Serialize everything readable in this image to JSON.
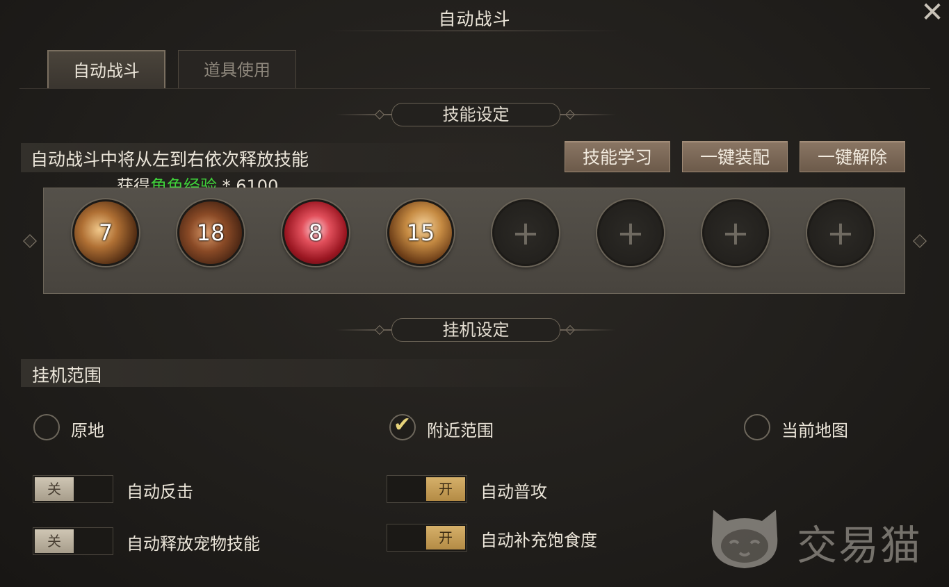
{
  "window": {
    "title": "自动战斗",
    "close_icon": "close-icon"
  },
  "tabs": [
    {
      "label": "自动战斗",
      "active": true
    },
    {
      "label": "道具使用",
      "active": false
    }
  ],
  "skill_section": {
    "header": "技能设定",
    "info": "自动战斗中将从左到右依次释放技能",
    "exp_prefix": "获得",
    "exp_highlight": "角色经验",
    "exp_suffix": " * 6100",
    "buttons": {
      "learn": "技能学习",
      "equip_all": "一键装配",
      "remove_all": "一键解除"
    },
    "slots": [
      {
        "level": "7",
        "icon": "sword-slash-skill-icon"
      },
      {
        "level": "18",
        "icon": "blade-skill-icon"
      },
      {
        "level": "8",
        "icon": "crimson-swirl-skill-icon"
      },
      {
        "level": "15",
        "icon": "golden-slash-skill-icon"
      },
      {
        "icon": "plus-icon"
      },
      {
        "icon": "plus-icon"
      },
      {
        "icon": "plus-icon"
      },
      {
        "icon": "plus-icon"
      }
    ]
  },
  "idle_section": {
    "header": "挂机设定",
    "range_label": "挂机范围",
    "range_options": [
      {
        "label": "原地",
        "selected": false
      },
      {
        "label": "附近范围",
        "selected": true
      },
      {
        "label": "当前地图",
        "selected": false
      }
    ],
    "toggles": {
      "auto_counter": {
        "label": "自动反击",
        "state": "关",
        "on": false
      },
      "auto_attack": {
        "label": "自动普攻",
        "state": "开",
        "on": true
      },
      "auto_pet_skill": {
        "label": "自动释放宠物技能",
        "state": "关",
        "on": false
      },
      "auto_refill_food": {
        "label": "自动补充饱食度",
        "state": "开",
        "on": true
      }
    }
  },
  "watermark": {
    "text": "交易猫",
    "icon": "cat-logo-icon"
  },
  "colors": {
    "exp_green": "#3fd13a",
    "button_brown": "#7a6654",
    "toggle_on": "#c9a055",
    "check": "#e6d27a"
  }
}
